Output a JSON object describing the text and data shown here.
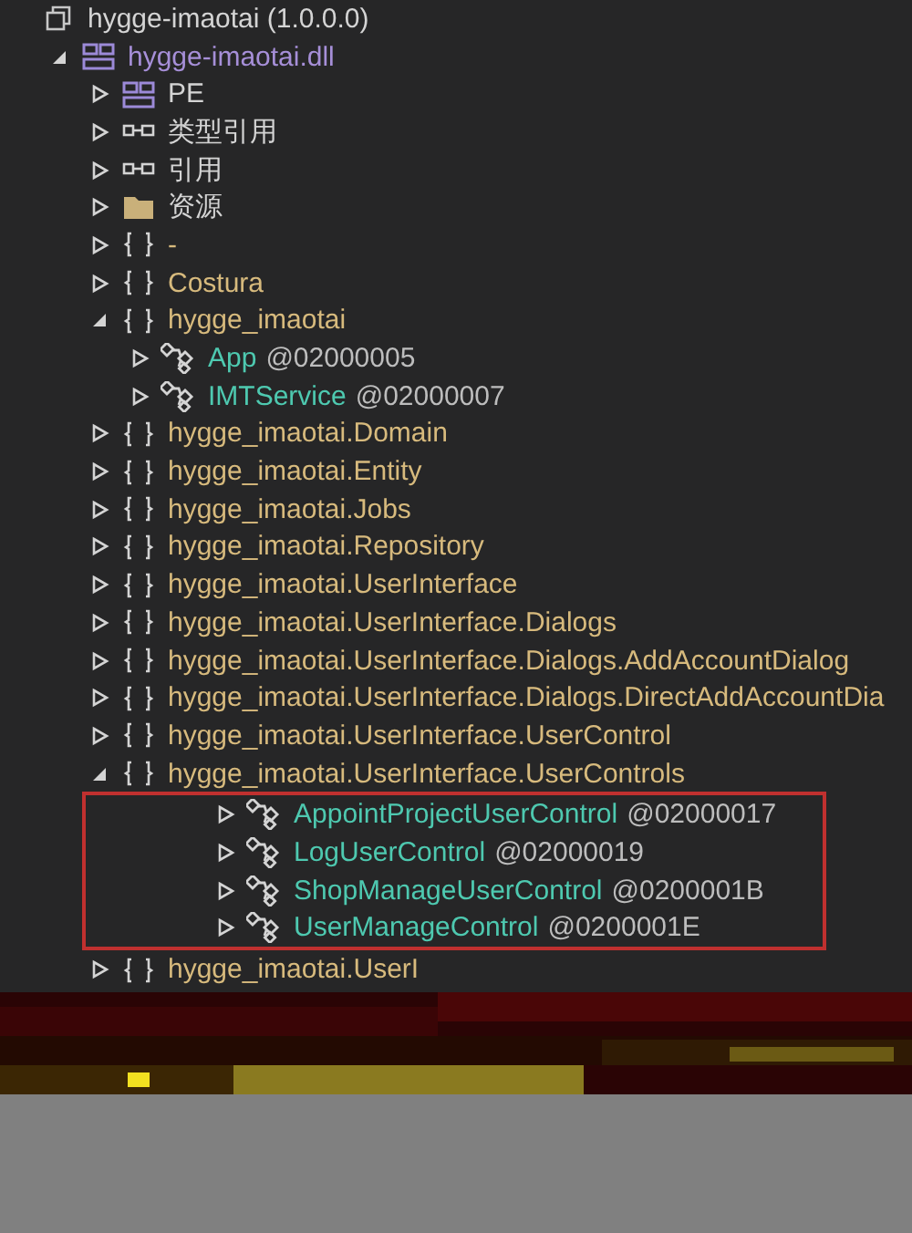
{
  "tree": [
    {
      "kind": "assembly",
      "label": "hygge-imaotai (1.0.0.0)",
      "children": [
        {
          "kind": "module",
          "label": "hygge-imaotai.dll",
          "expanded": true,
          "children": [
            {
              "kind": "pe",
              "label": "PE",
              "expanded": false
            },
            {
              "kind": "refs",
              "label": "类型引用",
              "expanded": false
            },
            {
              "kind": "refs",
              "label": "引用",
              "expanded": false
            },
            {
              "kind": "folder",
              "label": "资源",
              "expanded": false
            },
            {
              "kind": "namespace",
              "label": "-",
              "expanded": false
            },
            {
              "kind": "namespace",
              "label": "Costura",
              "expanded": false
            },
            {
              "kind": "namespace",
              "label": "hygge_imaotai",
              "expanded": true,
              "children": [
                {
                  "kind": "class",
                  "label": "App",
                  "token": "@02000005",
                  "expanded": false
                },
                {
                  "kind": "class",
                  "label": "IMTService",
                  "token": "@02000007",
                  "expanded": false
                }
              ]
            },
            {
              "kind": "namespace",
              "label": "hygge_imaotai.Domain",
              "expanded": false
            },
            {
              "kind": "namespace",
              "label": "hygge_imaotai.Entity",
              "expanded": false
            },
            {
              "kind": "namespace",
              "label": "hygge_imaotai.Jobs",
              "expanded": false
            },
            {
              "kind": "namespace",
              "label": "hygge_imaotai.Repository",
              "expanded": false
            },
            {
              "kind": "namespace",
              "label": "hygge_imaotai.UserInterface",
              "expanded": false
            },
            {
              "kind": "namespace",
              "label": "hygge_imaotai.UserInterface.Dialogs",
              "expanded": false
            },
            {
              "kind": "namespace",
              "label": "hygge_imaotai.UserInterface.Dialogs.AddAccountDialog",
              "expanded": false
            },
            {
              "kind": "namespace",
              "label": "hygge_imaotai.UserInterface.Dialogs.DirectAddAccountDia",
              "expanded": false
            },
            {
              "kind": "namespace",
              "label": "hygge_imaotai.UserInterface.UserControl",
              "expanded": false
            },
            {
              "kind": "namespace",
              "label": "hygge_imaotai.UserInterface.UserControls",
              "expanded": true,
              "framed": true,
              "children": [
                {
                  "kind": "class",
                  "label": "AppointProjectUserControl",
                  "token": "@02000017",
                  "expanded": false
                },
                {
                  "kind": "class",
                  "label": "LogUserControl",
                  "token": "@02000019",
                  "expanded": false
                },
                {
                  "kind": "class",
                  "label": "ShopManageUserControl",
                  "token": "@0200001B",
                  "expanded": false
                },
                {
                  "kind": "class",
                  "label": "UserManageControl",
                  "token": "@0200001E",
                  "expanded": false
                }
              ]
            },
            {
              "kind": "namespace",
              "label": "hygge_imaotai.UserI",
              "expanded": false
            }
          ]
        }
      ]
    }
  ]
}
